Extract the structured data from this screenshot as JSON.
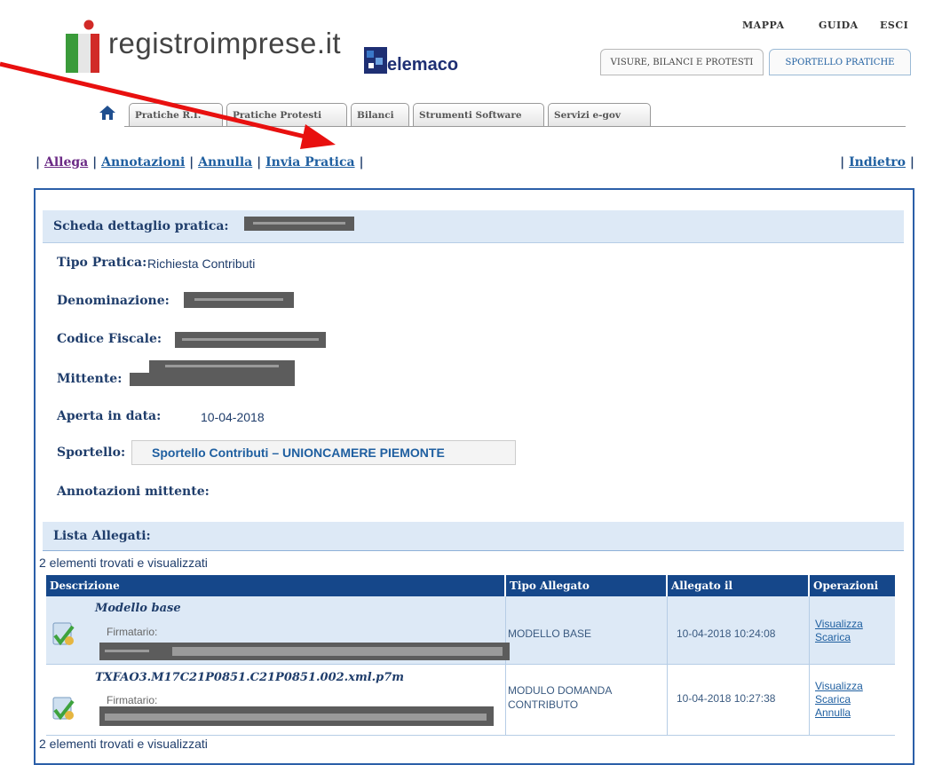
{
  "header": {
    "logo_text": "registroimprese.it",
    "telemaco": "elemaco",
    "top_links": [
      "MAPPA",
      "GUIDA",
      "ESCI"
    ],
    "top_tabs": [
      "VISURE, BILANCI E PROTESTI",
      "SPORTELLO PRATICHE"
    ]
  },
  "nav_tabs": [
    "Pratiche R.I.",
    "Pratiche Protesti",
    "Bilanci",
    "Strumenti Software",
    "Servizi e-gov"
  ],
  "actions": {
    "allega": "Allega",
    "annotazioni": "Annotazioni",
    "annulla": "Annulla",
    "invia": "Invia Pratica",
    "indietro": "Indietro"
  },
  "scheda": {
    "title": "Scheda dettaglio pratica:",
    "tipo_label": "Tipo Pratica:",
    "tipo_value": "Richiesta Contributi",
    "denominazione_label": "Denominazione:",
    "codice_label": "Codice Fiscale:",
    "mittente_label": "Mittente:",
    "aperta_label": "Aperta in data:",
    "aperta_value": "10-04-2018",
    "sportello_label": "Sportello:",
    "sportello_value": "Sportello Contributi – UNIONCAMERE PIEMONTE",
    "annotazioni_label": "Annotazioni mittente:"
  },
  "lista": {
    "title": "Lista Allegati:",
    "count_text": "2 elementi trovati e visualizzati",
    "columns": [
      "Descrizione",
      "Tipo Allegato",
      "Allegato il",
      "Operazioni"
    ],
    "rows": [
      {
        "name": "Modello base",
        "firmatario": "Firmatario:",
        "tipo": "MODELLO BASE",
        "tipo2": "",
        "date": "10-04-2018 10:24:08",
        "ops": [
          "Visualizza",
          "Scarica"
        ]
      },
      {
        "name": "TXFAO3.M17C21P0851.C21P0851.002.xml.p7m",
        "firmatario": "Firmatario:",
        "tipo": "MODULO DOMANDA",
        "tipo2": "CONTRIBUTO",
        "date": "10-04-2018 10:27:38",
        "ops": [
          "Visualizza",
          "Scarica",
          "Annulla"
        ]
      }
    ]
  },
  "colors": {
    "accent": "#2b5fa8",
    "header_bg": "#15478a",
    "row_bg": "#dde9f6",
    "arrow": "#e8100f"
  }
}
